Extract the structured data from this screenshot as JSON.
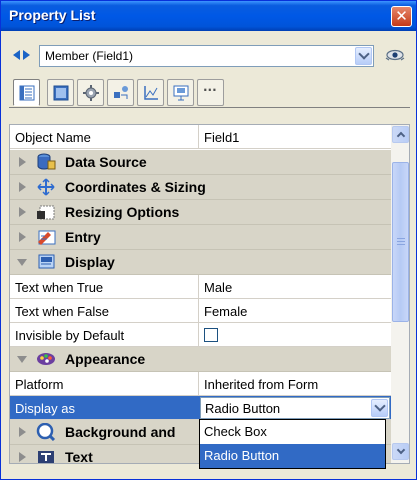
{
  "window": {
    "title": "Property List",
    "close_label": "✕"
  },
  "member": {
    "value": "Member (Field1)"
  },
  "toolbar": {
    "tabs": [
      "properties",
      "layout",
      "settings",
      "shapes",
      "chart",
      "presentation",
      "more"
    ],
    "more_label": "···"
  },
  "grid": {
    "object_name": {
      "name": "Object Name",
      "value": "Field1"
    },
    "categories": {
      "data_source": "Data Source",
      "coordinates": "Coordinates & Sizing",
      "resizing": "Resizing Options",
      "entry": "Entry",
      "display": "Display",
      "appearance": "Appearance",
      "background": "Background and",
      "text": "Text"
    },
    "display": {
      "text_true": {
        "name": "Text when True",
        "value": "Male"
      },
      "text_false": {
        "name": "Text when False",
        "value": "Female"
      },
      "invisible": {
        "name": "Invisible by Default",
        "checked": false
      }
    },
    "appearance": {
      "platform": {
        "name": "Platform",
        "value": "Inherited from Form"
      },
      "display_as": {
        "name": "Display as",
        "value": "Radio Button"
      }
    }
  },
  "popup": {
    "options": [
      "Check Box",
      "Radio Button"
    ],
    "selected": "Radio Button"
  },
  "colors": {
    "selection": "#316ac5",
    "title_bar": "#0058e6",
    "category_bg": "#d8d5c8"
  }
}
